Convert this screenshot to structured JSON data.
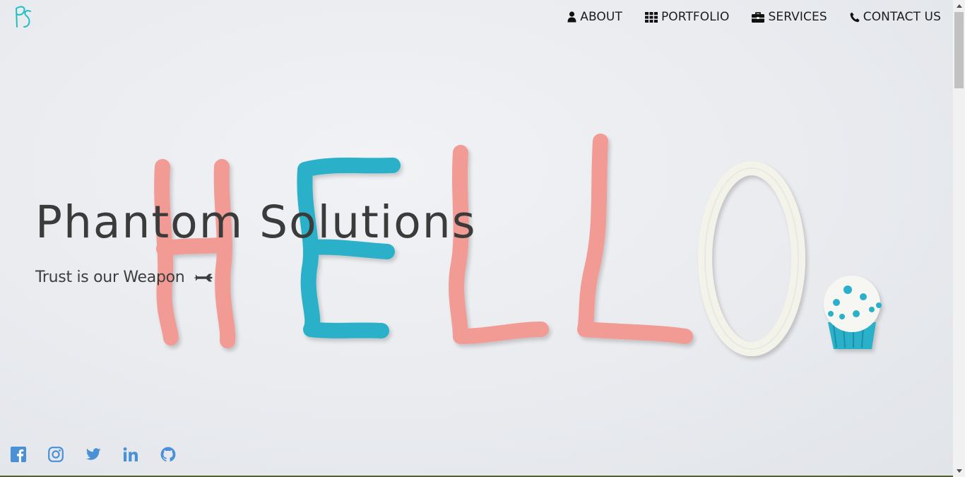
{
  "brand": {
    "logo_text": "PS",
    "logo_color": "#1fbfc4"
  },
  "nav": {
    "items": [
      {
        "label": "ABOUT",
        "icon": "user-icon"
      },
      {
        "label": "PORTFOLIO",
        "icon": "grid-icon"
      },
      {
        "label": "SERVICES",
        "icon": "briefcase-icon"
      },
      {
        "label": "CONTACT US",
        "icon": "phone-icon"
      }
    ]
  },
  "hero": {
    "title": "Phantom Solutions",
    "tagline": "Trust is our Weapon",
    "tagline_icon": "plane-icon",
    "background_word": "HELLO."
  },
  "social": {
    "color": "#4a90d6",
    "items": [
      {
        "icon": "facebook-icon"
      },
      {
        "icon": "instagram-icon"
      },
      {
        "icon": "twitter-icon"
      },
      {
        "icon": "linkedin-icon"
      },
      {
        "icon": "github-icon"
      }
    ]
  },
  "colors": {
    "clay_pink": "#f29a94",
    "clay_blue": "#2bb1c9",
    "clay_white": "#f4f3ea"
  }
}
